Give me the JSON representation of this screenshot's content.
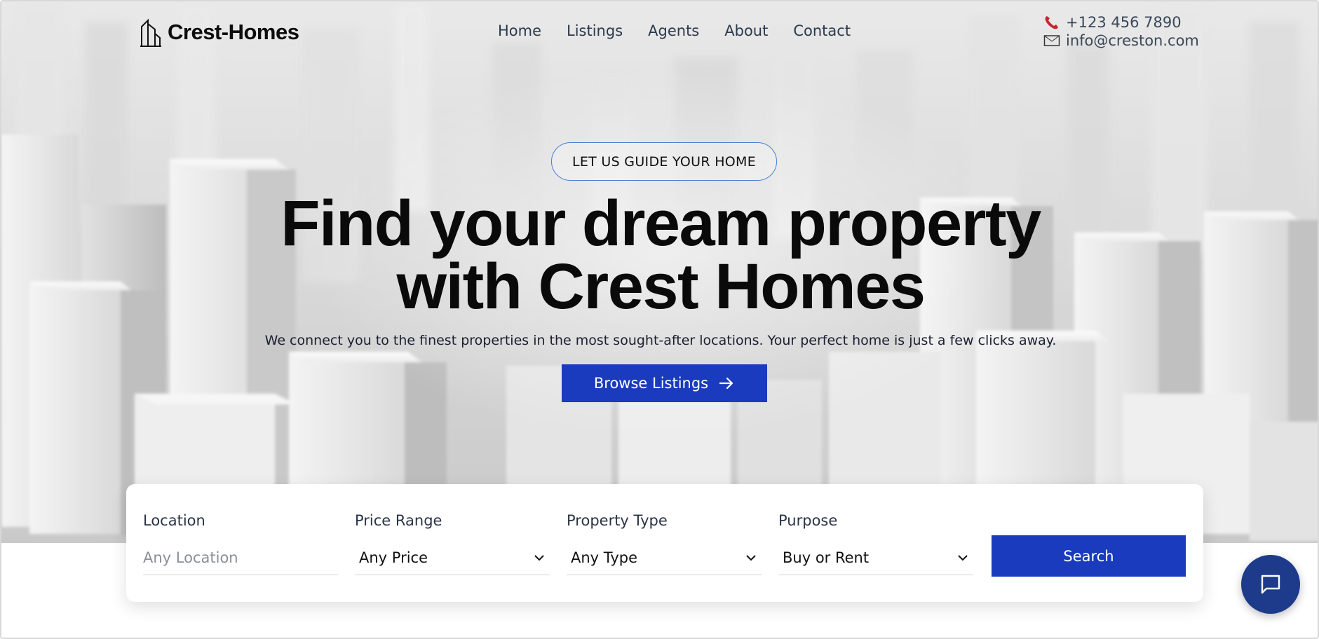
{
  "brand": {
    "name": "Crest-Homes"
  },
  "nav": {
    "items": [
      {
        "label": "Home"
      },
      {
        "label": "Listings"
      },
      {
        "label": "Agents"
      },
      {
        "label": "About"
      },
      {
        "label": "Contact"
      }
    ]
  },
  "contact": {
    "phone": "+123 456 7890",
    "email": "info@creston.com",
    "phone_icon": "phone-icon",
    "email_icon": "mail-icon"
  },
  "hero": {
    "tagline": "LET US GUIDE YOUR HOME",
    "headline_line1": "Find your dream property",
    "headline_line2": "with Crest Homes",
    "subtext": "We connect you to the finest properties in the most sought-after locations. Your perfect home is just a few clicks away.",
    "cta_label": "Browse Listings"
  },
  "search": {
    "location": {
      "label": "Location",
      "placeholder": "Any Location"
    },
    "price": {
      "label": "Price Range",
      "value": "Any Price"
    },
    "type": {
      "label": "Property Type",
      "value": "Any Type"
    },
    "purpose": {
      "label": "Purpose",
      "value": "Buy or Rent"
    },
    "button_label": "Search"
  },
  "colors": {
    "accent": "#1a3bbd",
    "chat_bg": "#1e3a8a",
    "pill_border": "#4a7ed8"
  }
}
